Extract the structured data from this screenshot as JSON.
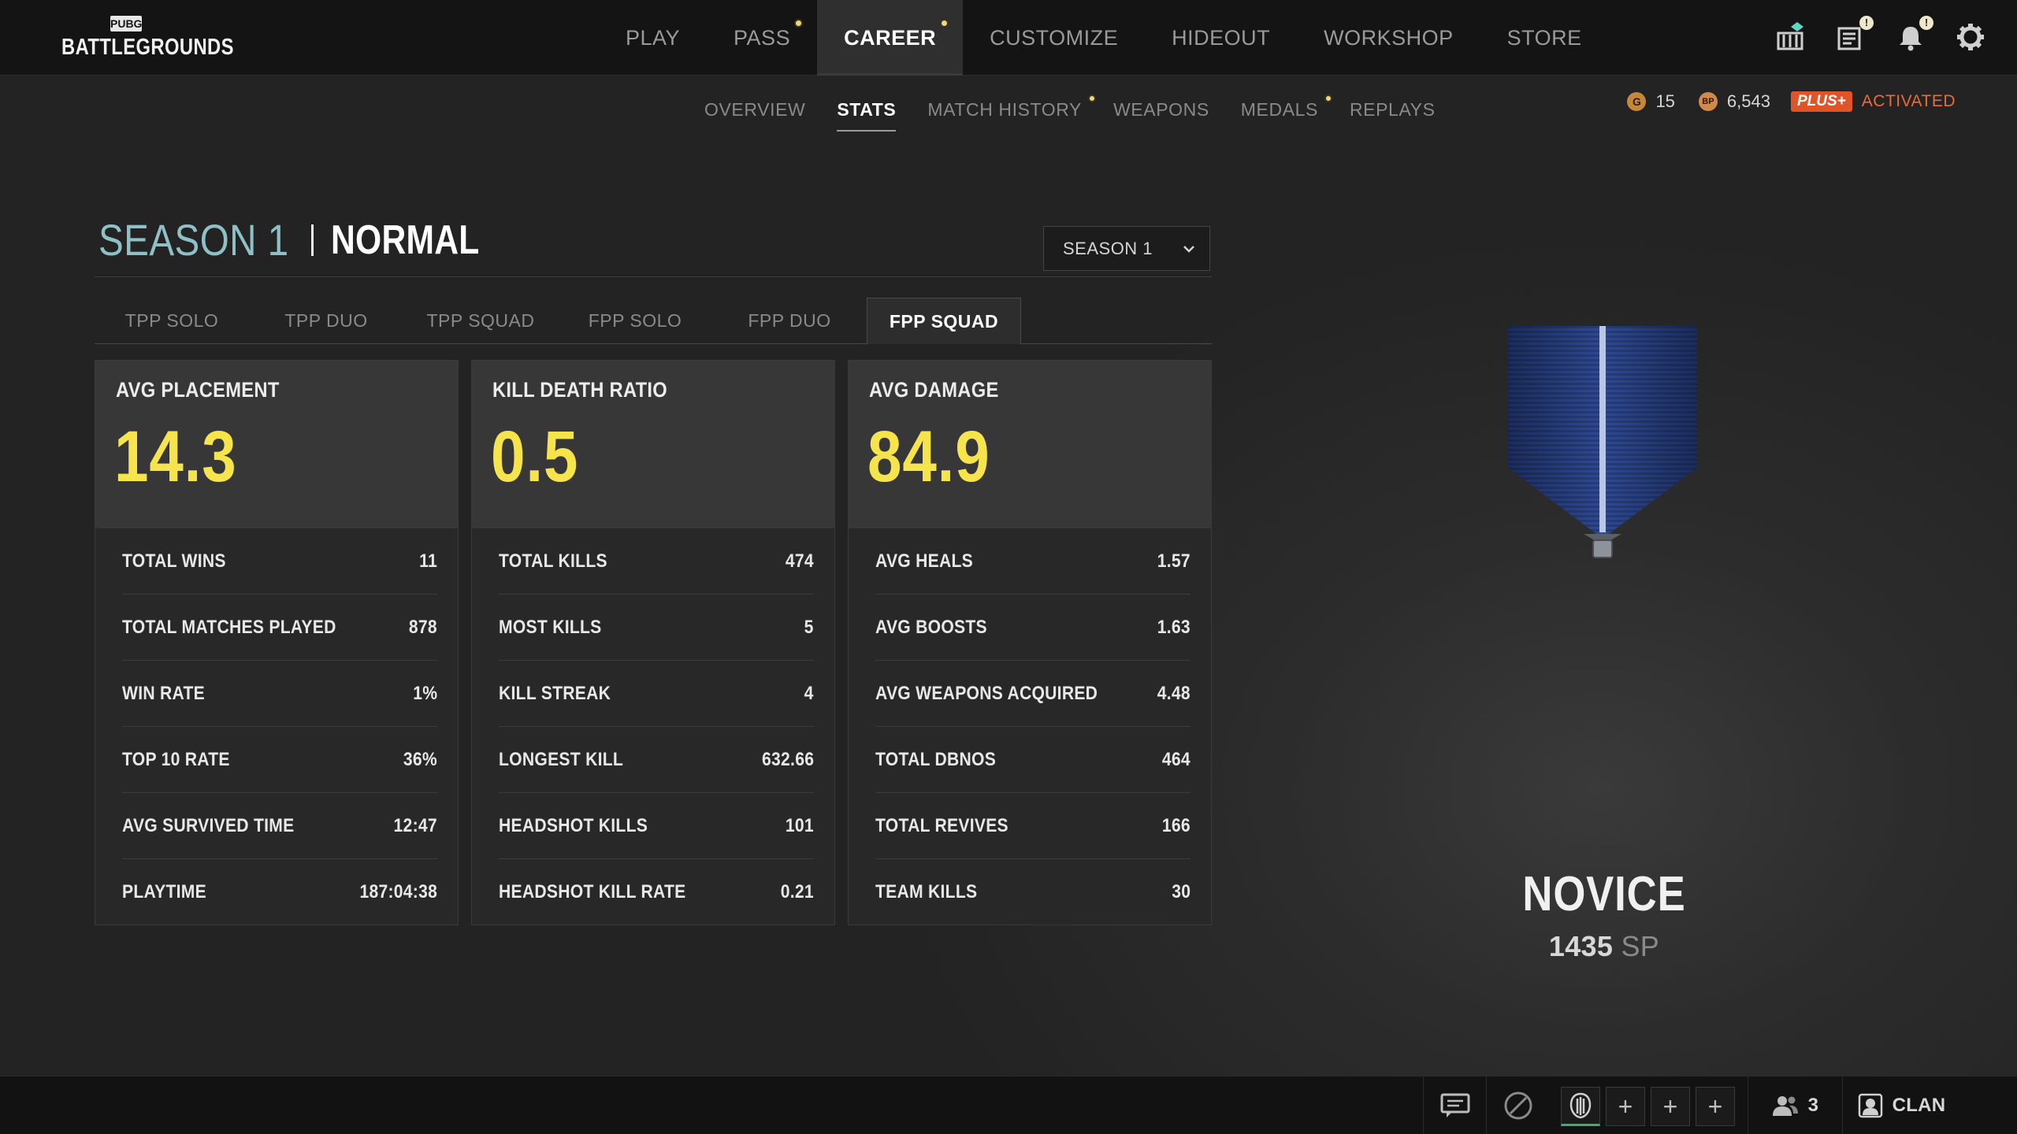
{
  "app": {
    "logo_small": "PUBG",
    "logo_main": "BATTLEGROUNDS"
  },
  "main_nav": [
    {
      "label": "PLAY"
    },
    {
      "label": "PASS"
    },
    {
      "label": "CAREER"
    },
    {
      "label": "CUSTOMIZE"
    },
    {
      "label": "HIDEOUT"
    },
    {
      "label": "WORKSHOP"
    },
    {
      "label": "STORE"
    }
  ],
  "top_icons": [
    "store-crate-icon",
    "news-icon",
    "bell-icon",
    "gear-icon"
  ],
  "sub_nav": [
    {
      "label": "OVERVIEW"
    },
    {
      "label": "STATS"
    },
    {
      "label": "MATCH HISTORY"
    },
    {
      "label": "WEAPONS"
    },
    {
      "label": "MEDALS"
    },
    {
      "label": "REPLAYS"
    }
  ],
  "currency": {
    "g_coin_symbol": "G",
    "g_coin": "15",
    "bp_symbol": "BP",
    "bp": "6,543",
    "plus_label": "PLUS+",
    "plus_status": "ACTIVATED"
  },
  "season_header": {
    "season": "SEASON 1",
    "mode": "NORMAL",
    "select_value": "SEASON 1"
  },
  "mode_tabs": [
    {
      "label": "TPP SOLO"
    },
    {
      "label": "TPP DUO"
    },
    {
      "label": "TPP SQUAD"
    },
    {
      "label": "FPP SOLO"
    },
    {
      "label": "FPP DUO"
    },
    {
      "label": "FPP SQUAD"
    }
  ],
  "cards": [
    {
      "title": "AVG PLACEMENT",
      "value": "14.3",
      "rows": [
        {
          "label": "TOTAL WINS",
          "value": "11"
        },
        {
          "label": "TOTAL MATCHES PLAYED",
          "value": "878"
        },
        {
          "label": "WIN RATE",
          "value": "1%"
        },
        {
          "label": "TOP 10 RATE",
          "value": "36%"
        },
        {
          "label": "AVG SURVIVED TIME",
          "value": "12:47"
        },
        {
          "label": "PLAYTIME",
          "value": "187:04:38"
        }
      ]
    },
    {
      "title": "KILL DEATH RATIO",
      "value": "0.5",
      "rows": [
        {
          "label": "TOTAL KILLS",
          "value": "474"
        },
        {
          "label": "MOST KILLS",
          "value": "5"
        },
        {
          "label": "KILL STREAK",
          "value": "4"
        },
        {
          "label": "LONGEST KILL",
          "value": "632.66"
        },
        {
          "label": "HEADSHOT KILLS",
          "value": "101"
        },
        {
          "label": "HEADSHOT KILL RATE",
          "value": "0.21"
        }
      ]
    },
    {
      "title": "AVG DAMAGE",
      "value": "84.9",
      "rows": [
        {
          "label": "AVG HEALS",
          "value": "1.57"
        },
        {
          "label": "AVG BOOSTS",
          "value": "1.63"
        },
        {
          "label": "AVG WEAPONS ACQUIRED",
          "value": "4.48"
        },
        {
          "label": "TOTAL DBNOS",
          "value": "464"
        },
        {
          "label": "TOTAL REVIVES",
          "value": "166"
        },
        {
          "label": "TEAM KILLS",
          "value": "30"
        }
      ]
    }
  ],
  "rank": {
    "name": "NOVICE",
    "points": "1435",
    "unit": "SP"
  },
  "bottom_bar": {
    "slot_add": "+",
    "friends_count": "3",
    "clan_label": "CLAN"
  },
  "colors": {
    "accent_yellow": "#f6e44c",
    "season_teal": "#8fc0c6",
    "plus_orange": "#e0542a",
    "notify_dot": "#f2d77a"
  }
}
